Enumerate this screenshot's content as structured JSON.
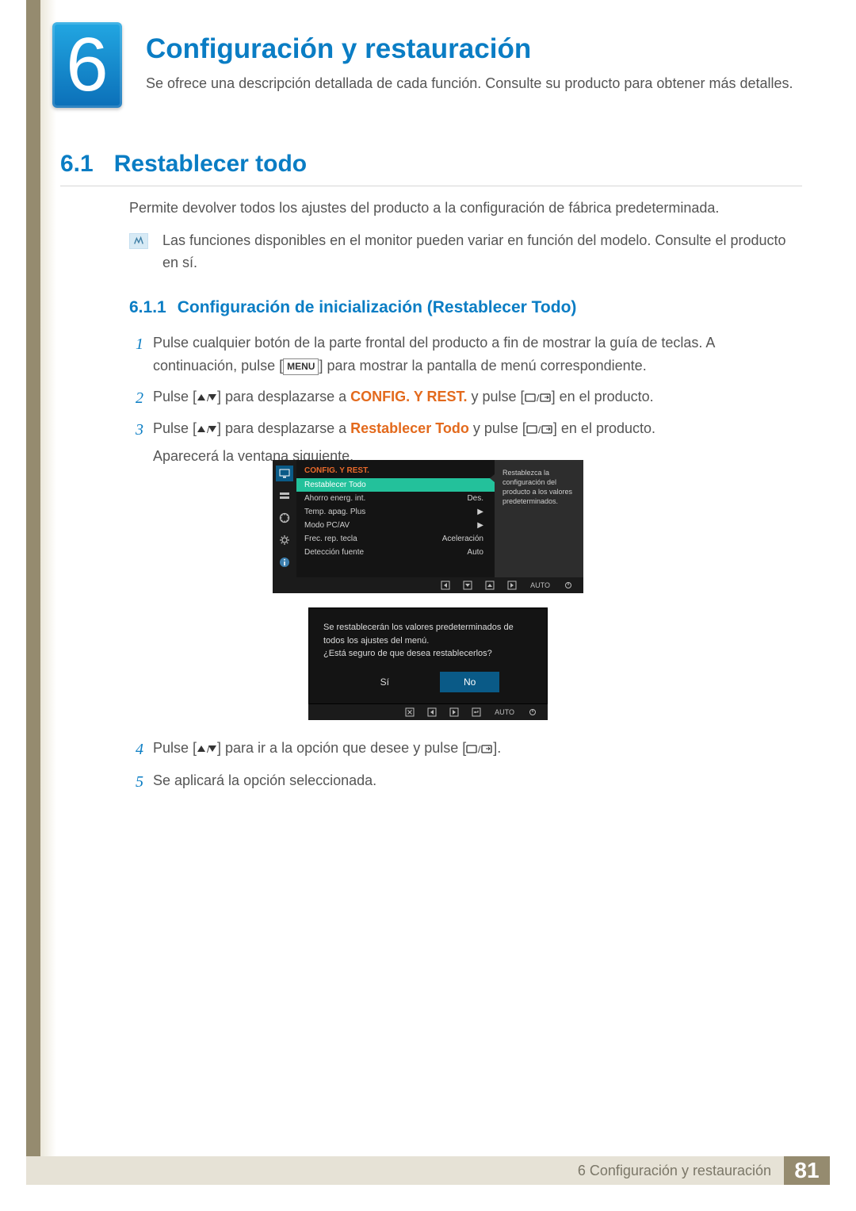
{
  "chapter": {
    "number": "6",
    "title": "Configuración y restauración",
    "intro": "Se ofrece una descripción detallada de cada función. Consulte su producto para obtener más detalles."
  },
  "section": {
    "number": "6.1",
    "title": "Restablecer todo",
    "desc": "Permite devolver todos los ajustes del producto a la configuración de fábrica predeterminada.",
    "note": "Las funciones disponibles en el monitor pueden variar en función del modelo. Consulte el producto en sí."
  },
  "subsection": {
    "number": "6.1.1",
    "title": "Configuración de inicialización (Restablecer Todo)"
  },
  "steps": {
    "1": {
      "pre": "Pulse cualquier botón de la parte frontal del producto a fin de mostrar la guía de teclas. A continuación, pulse [",
      "btn": "MENU",
      "post": "] para mostrar la pantalla de menú correspondiente."
    },
    "2": {
      "a": "Pulse [",
      "b": "] para desplazarse a ",
      "kw": "CONFIG. Y REST.",
      "c": " y pulse [",
      "d": "] en el producto."
    },
    "3": {
      "a": "Pulse [",
      "b": "] para desplazarse a ",
      "kw": "Restablecer Todo",
      "c": " y pulse [",
      "d": "] en el producto.",
      "e": "Aparecerá la ventana siguiente."
    },
    "4": {
      "a": "Pulse [",
      "b": "] para ir a la opción que desee y pulse [",
      "c": "]."
    },
    "5": "Se aplicará la opción seleccionada."
  },
  "osd": {
    "menuTitle": "CONFIG. Y REST.",
    "tooltip": "Restablezca la configuración del producto a los valores predeterminados.",
    "rows": [
      {
        "label": "Restablecer Todo",
        "value": "",
        "selected": true
      },
      {
        "label": "Ahorro energ. int.",
        "value": "Des."
      },
      {
        "label": "Temp. apag. Plus",
        "value": "▶"
      },
      {
        "label": "Modo PC/AV",
        "value": "▶"
      },
      {
        "label": "Frec. rep. tecla",
        "value": "Aceleración"
      },
      {
        "label": "Detección fuente",
        "value": "Auto"
      }
    ],
    "nav_auto": "AUTO",
    "dialog": {
      "line1": "Se restablecerán los valores predeterminados de todos los ajustes del menú.",
      "line2": "¿Está seguro de que desea restablecerlos?",
      "yes": "Sí",
      "no": "No"
    }
  },
  "footer": {
    "label": "6 Configuración y restauración",
    "page": "81"
  }
}
